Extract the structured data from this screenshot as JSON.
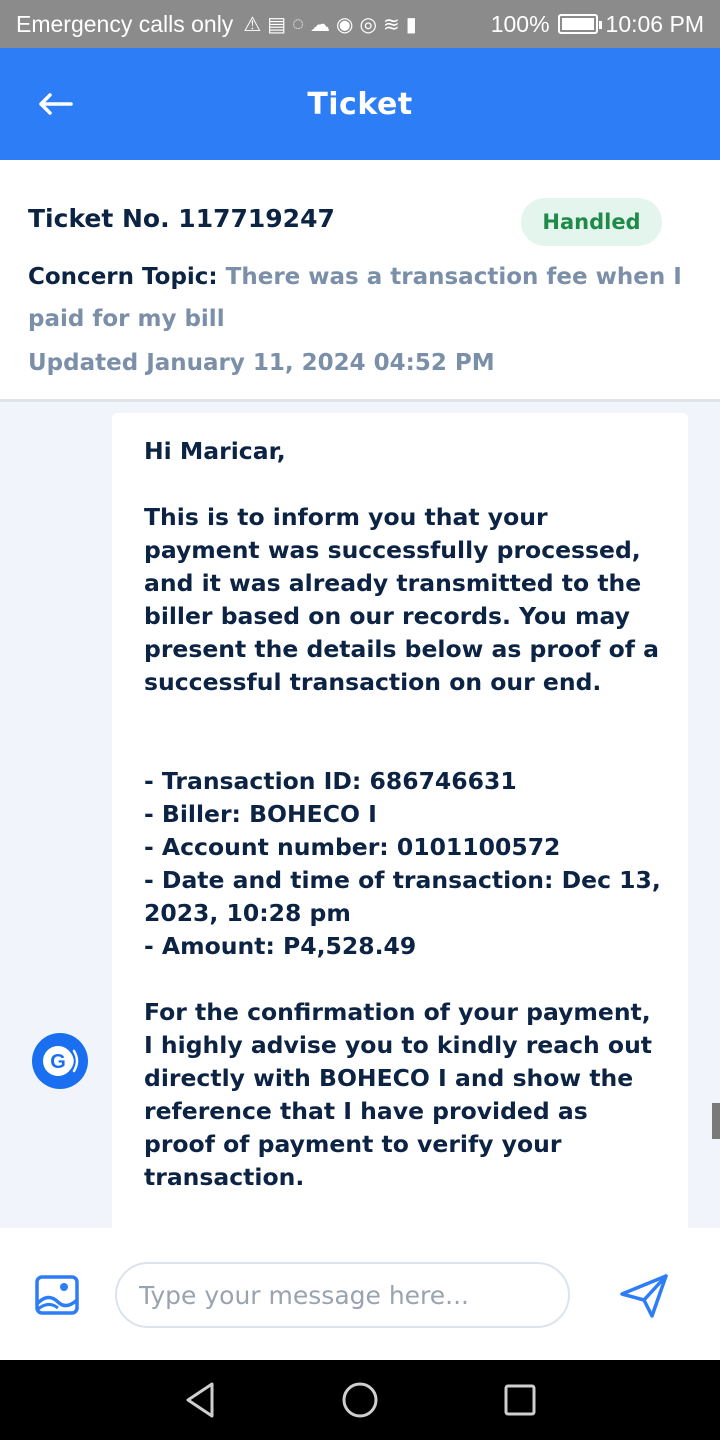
{
  "status_bar": {
    "carrier": "Emergency calls only",
    "icons": [
      "warning-icon",
      "calendar-icon",
      "messenger-icon",
      "cloud-icon",
      "chrome-icon",
      "eye-icon",
      "wifi-icon",
      "signal-icon"
    ],
    "battery": "100%",
    "battery_level": 1.0,
    "time": "10:06 PM"
  },
  "app_bar": {
    "title": "Ticket",
    "back_icon": "arrow-left-icon"
  },
  "ticket": {
    "number_label": "Ticket No. 117719247",
    "status": "Handled",
    "topic_label": "Concern Topic:",
    "topic_value": "There was a transaction fee when I paid for my bill",
    "updated": "Updated January 11, 2024 04:52 PM"
  },
  "messages": [
    {
      "sender_icon": "gcash-g-icon",
      "text": "Hi Maricar,\n\nThis is to inform you that your payment was successfully processed, and it was already transmitted to the biller based on our records. You may present the details below as proof of a successful transaction on our end.\n\n\n- Transaction ID: 686746631\n- Biller: BOHECO I\n- Account number: 0101100572\n- Date and time of transaction: Dec 13, 2023, 10:28 pm\n- Amount: P4,528.49\n\nFor the confirmation of your payment, I highly advise you to kindly reach out directly with BOHECO I and show the reference that I have provided as proof of payment to verify your transaction.\n\nIf the biller insists on not capturing the"
    }
  ],
  "composer": {
    "placeholder": "Type your message here...",
    "attach_icon": "image-attach-icon",
    "send_icon": "send-icon"
  },
  "nav_bar": {
    "icons": [
      "back-triangle-icon",
      "home-circle-icon",
      "recents-square-icon"
    ]
  },
  "colors": {
    "primary": "#2d7df6",
    "text_dark": "#0c2344",
    "text_muted": "#7b8fa9",
    "badge_bg": "#e3f5ec",
    "badge_text": "#1f8a4a"
  }
}
